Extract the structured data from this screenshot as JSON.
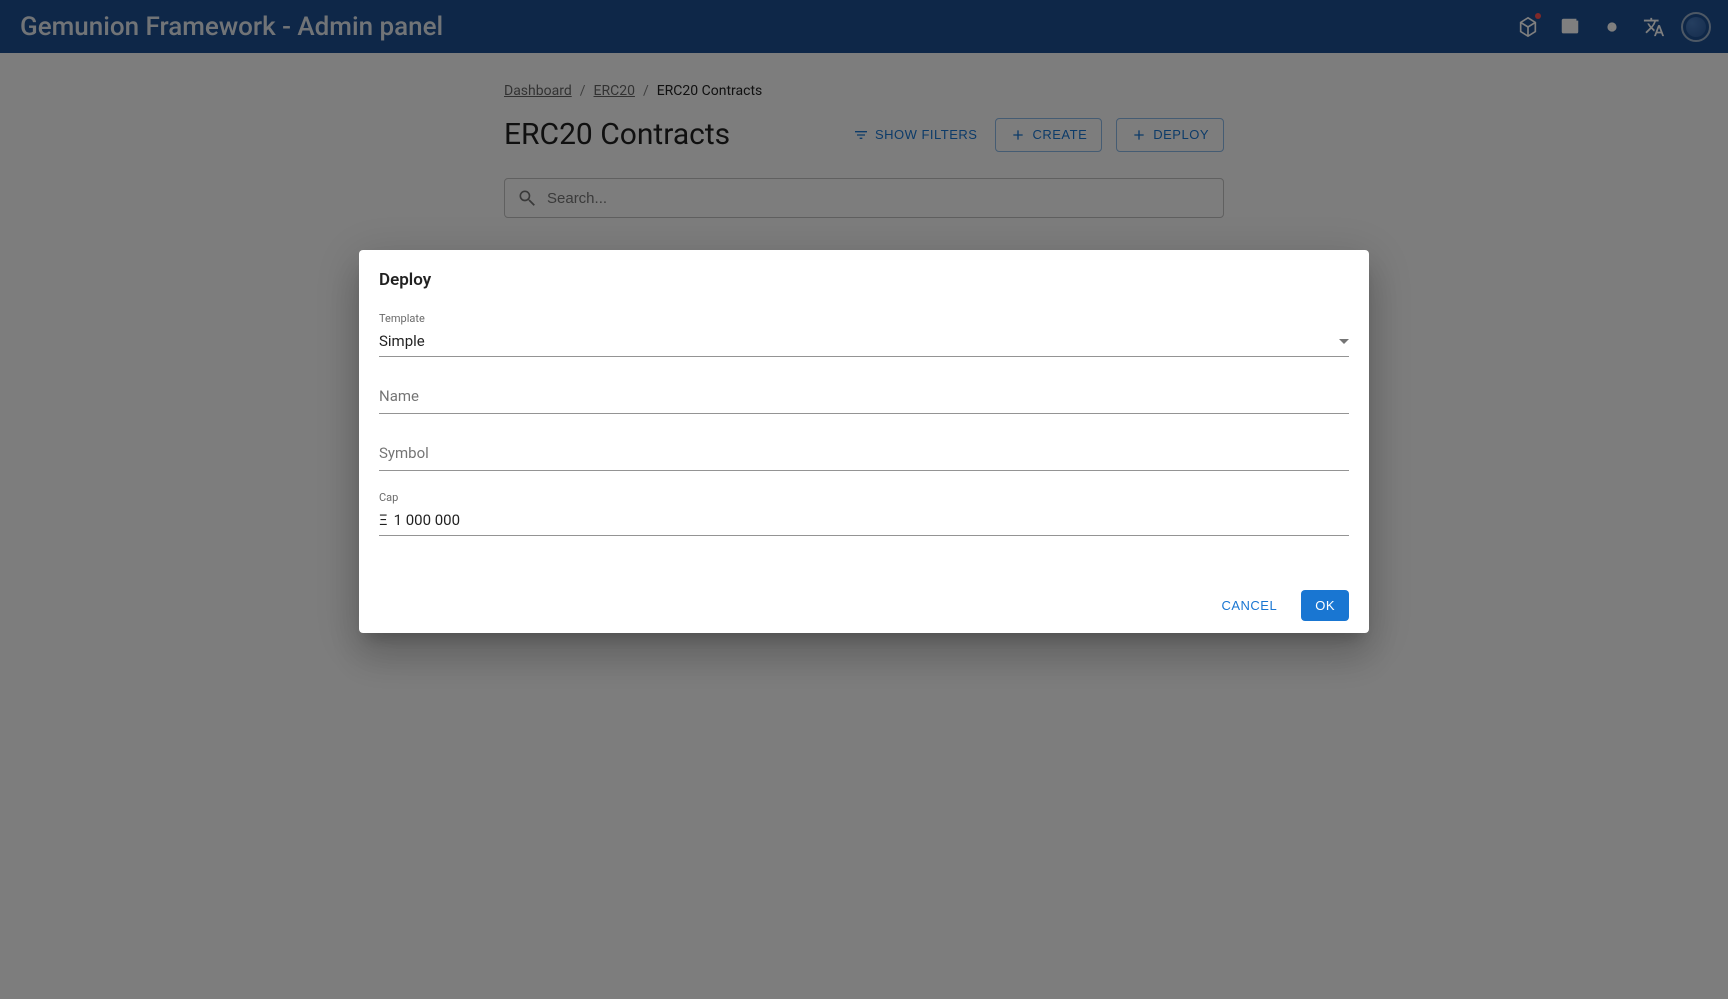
{
  "appbar": {
    "title": "Gemunion Framework - Admin panel"
  },
  "breadcrumbs": {
    "dashboard": "Dashboard",
    "erc20": "ERC20",
    "current": "ERC20 Contracts"
  },
  "page": {
    "title": "ERC20 Contracts",
    "show_filters": "SHOW FILTERS",
    "create": "CREATE",
    "deploy": "DEPLOY",
    "search_placeholder": "Search..."
  },
  "dialog": {
    "title": "Deploy",
    "template_label": "Template",
    "template_value": "Simple",
    "name_label": "Name",
    "symbol_label": "Symbol",
    "cap_label": "Cap",
    "cap_prefix": "Ξ",
    "cap_value": "1 000 000",
    "cancel": "CANCEL",
    "ok": "OK"
  }
}
